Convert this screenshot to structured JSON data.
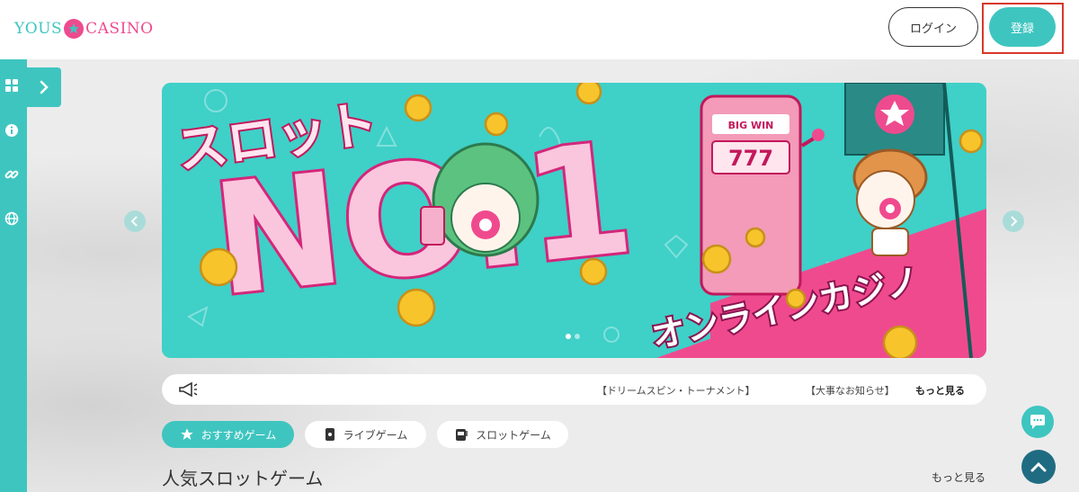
{
  "header": {
    "logo_left": "YOUS",
    "logo_right": "CASINO",
    "login_label": "ログイン",
    "register_label": "登録"
  },
  "sidebar": {
    "icons": [
      "grid-icon",
      "info-icon",
      "link-icon",
      "globe-icon"
    ],
    "expand_icon": "chevron-right-icon"
  },
  "banner": {
    "headline_top": "スロット",
    "headline_main": "NO.1",
    "headline_bottom": "オンラインカジノ",
    "machine_label": "BIG WIN",
    "machine_digits": "777"
  },
  "newsbar": {
    "items": [
      "【ドリームスピン・トーナメント】",
      "【大事なお知らせ】"
    ],
    "more_label": "もっと見る"
  },
  "tabs": [
    {
      "label": "おすすめゲーム",
      "icon": "star-icon",
      "active": true
    },
    {
      "label": "ライブゲーム",
      "icon": "cards-icon",
      "active": false
    },
    {
      "label": "スロットゲーム",
      "icon": "slot-machine-icon",
      "active": false
    }
  ],
  "section": {
    "title": "人気スロットゲーム",
    "more_label": "もっと見る"
  },
  "colors": {
    "accent": "#3fc5c0",
    "brand_pink": "#ee4b8f",
    "scroll_top": "#1f6c82",
    "highlight_frame": "#d8372b"
  }
}
